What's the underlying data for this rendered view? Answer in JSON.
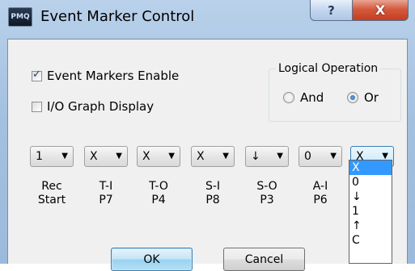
{
  "window": {
    "title": "Event Marker Control",
    "icon_text": "PMQ",
    "help_glyph": "?",
    "close_glyph": "X"
  },
  "options": {
    "event_markers_label": "Event Markers Enable",
    "event_markers_checked": true,
    "io_graph_label": "I/O Graph Display",
    "io_graph_checked": false
  },
  "logical_operation": {
    "title": "Logical Operation",
    "and_label": "And",
    "or_label": "Or",
    "selected": "Or"
  },
  "combos": [
    {
      "value": "1",
      "label_line1": "Rec",
      "label_line2": "Start"
    },
    {
      "value": "X",
      "label_line1": "T-I",
      "label_line2": "P7"
    },
    {
      "value": "X",
      "label_line1": "T-O",
      "label_line2": "P4"
    },
    {
      "value": "X",
      "label_line1": "S-I",
      "label_line2": "P8"
    },
    {
      "value": "↓",
      "label_line1": "S-O",
      "label_line2": "P3"
    },
    {
      "value": "0",
      "label_line1": "A-I",
      "label_line2": "P6"
    },
    {
      "value": "X",
      "label_line1": "",
      "label_line2": ""
    }
  ],
  "dropdown": {
    "items": [
      "X",
      "0",
      "↓",
      "1",
      "↑",
      "C"
    ],
    "selected_index": 0
  },
  "buttons": {
    "ok_label": "OK",
    "cancel_label": "Cancel"
  },
  "colors": {
    "selection": "#3399ff",
    "close_button": "#c43c1f",
    "frame": "#a4c0e0"
  },
  "icons": {
    "combo_arrow": "▼"
  }
}
